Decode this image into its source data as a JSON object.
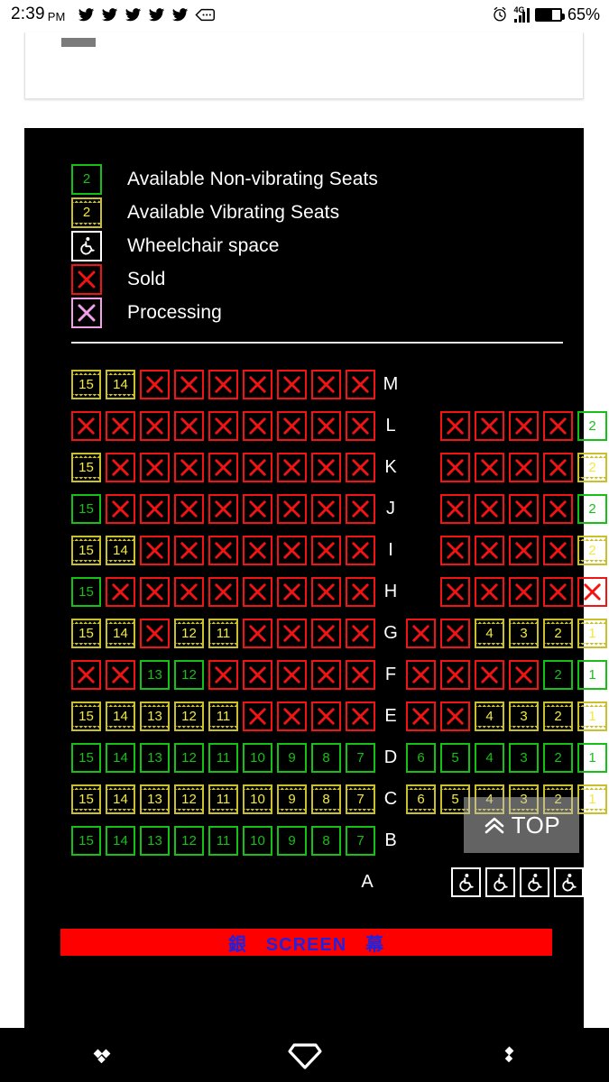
{
  "status_bar": {
    "time": "2:39",
    "ampm": "PM",
    "notification_icons": [
      "twitter-icon",
      "twitter-icon",
      "twitter-icon",
      "twitter-icon",
      "twitter-icon",
      "message-icon"
    ],
    "alarm_icon": "alarm-clock-icon",
    "network": "4G",
    "signal_bars": 4,
    "battery_percent": "65%",
    "battery_level": 65
  },
  "legend": {
    "items": [
      {
        "label": "Available Non-vibrating Seats",
        "style": "green",
        "text": "2",
        "icon": ""
      },
      {
        "label": "Available Vibrating Seats",
        "style": "vib",
        "text": "2",
        "icon": ""
      },
      {
        "label": "Wheelchair space",
        "style": "wheel",
        "text": "",
        "icon": "wheelchair-icon"
      },
      {
        "label": "Sold",
        "style": "sold",
        "text": "",
        "icon": "x-icon"
      },
      {
        "label": "Processing",
        "style": "proc",
        "text": "",
        "icon": "x-icon"
      }
    ]
  },
  "colors": {
    "available_green": "#16c116",
    "vibrating_yellow": "#c9c02c",
    "vibrating_text": "#f2ea3c",
    "sold_red": "#f21414",
    "processing_pink": "#f2a0e8",
    "wheelchair_white": "#ffffff",
    "panel_background": "#000000",
    "screen_bar_background": "#ff0000",
    "screen_bar_text": "#2222dd"
  },
  "seat_map": {
    "rows": [
      {
        "label": "M",
        "left": [
          {
            "t": "vib",
            "n": "15"
          },
          {
            "t": "vib",
            "n": "14"
          },
          {
            "t": "sold"
          },
          {
            "t": "sold"
          },
          {
            "t": "sold"
          },
          {
            "t": "sold"
          },
          {
            "t": "sold"
          },
          {
            "t": "sold"
          },
          {
            "t": "sold"
          }
        ],
        "right": []
      },
      {
        "label": "L",
        "left": [
          {
            "t": "sold"
          },
          {
            "t": "sold"
          },
          {
            "t": "sold"
          },
          {
            "t": "sold"
          },
          {
            "t": "sold"
          },
          {
            "t": "sold"
          },
          {
            "t": "sold"
          },
          {
            "t": "sold"
          },
          {
            "t": "sold"
          }
        ],
        "right": [
          {
            "t": "sold"
          },
          {
            "t": "sold"
          },
          {
            "t": "sold"
          },
          {
            "t": "sold"
          },
          {
            "t": "green",
            "n": "2"
          }
        ]
      },
      {
        "label": "K",
        "left": [
          {
            "t": "vib",
            "n": "15"
          },
          {
            "t": "sold"
          },
          {
            "t": "sold"
          },
          {
            "t": "sold"
          },
          {
            "t": "sold"
          },
          {
            "t": "sold"
          },
          {
            "t": "sold"
          },
          {
            "t": "sold"
          },
          {
            "t": "sold"
          }
        ],
        "right": [
          {
            "t": "sold"
          },
          {
            "t": "sold"
          },
          {
            "t": "sold"
          },
          {
            "t": "sold"
          },
          {
            "t": "vib",
            "n": "2"
          }
        ]
      },
      {
        "label": "J",
        "left": [
          {
            "t": "green",
            "n": "15"
          },
          {
            "t": "sold"
          },
          {
            "t": "sold"
          },
          {
            "t": "sold"
          },
          {
            "t": "sold"
          },
          {
            "t": "sold"
          },
          {
            "t": "sold"
          },
          {
            "t": "sold"
          },
          {
            "t": "sold"
          }
        ],
        "right": [
          {
            "t": "sold"
          },
          {
            "t": "sold"
          },
          {
            "t": "sold"
          },
          {
            "t": "sold"
          },
          {
            "t": "green",
            "n": "2"
          }
        ]
      },
      {
        "label": "I",
        "left": [
          {
            "t": "vib",
            "n": "15"
          },
          {
            "t": "vib",
            "n": "14"
          },
          {
            "t": "sold"
          },
          {
            "t": "sold"
          },
          {
            "t": "sold"
          },
          {
            "t": "sold"
          },
          {
            "t": "sold"
          },
          {
            "t": "sold"
          },
          {
            "t": "sold"
          }
        ],
        "right": [
          {
            "t": "sold"
          },
          {
            "t": "sold"
          },
          {
            "t": "sold"
          },
          {
            "t": "sold"
          },
          {
            "t": "vib",
            "n": "2"
          }
        ]
      },
      {
        "label": "H",
        "left": [
          {
            "t": "green",
            "n": "15"
          },
          {
            "t": "sold"
          },
          {
            "t": "sold"
          },
          {
            "t": "sold"
          },
          {
            "t": "sold"
          },
          {
            "t": "sold"
          },
          {
            "t": "sold"
          },
          {
            "t": "sold"
          },
          {
            "t": "sold"
          }
        ],
        "right": [
          {
            "t": "sold"
          },
          {
            "t": "sold"
          },
          {
            "t": "sold"
          },
          {
            "t": "sold"
          },
          {
            "t": "sold"
          }
        ]
      },
      {
        "label": "G",
        "left": [
          {
            "t": "vib",
            "n": "15"
          },
          {
            "t": "vib",
            "n": "14"
          },
          {
            "t": "sold"
          },
          {
            "t": "vib",
            "n": "12"
          },
          {
            "t": "vib",
            "n": "11"
          },
          {
            "t": "sold"
          },
          {
            "t": "sold"
          },
          {
            "t": "sold"
          },
          {
            "t": "sold"
          }
        ],
        "right": [
          {
            "t": "sold"
          },
          {
            "t": "sold"
          },
          {
            "t": "vib",
            "n": "4"
          },
          {
            "t": "vib",
            "n": "3"
          },
          {
            "t": "vib",
            "n": "2"
          },
          {
            "t": "vib",
            "n": "1"
          }
        ]
      },
      {
        "label": "F",
        "left": [
          {
            "t": "sold"
          },
          {
            "t": "sold"
          },
          {
            "t": "green",
            "n": "13"
          },
          {
            "t": "green",
            "n": "12"
          },
          {
            "t": "sold"
          },
          {
            "t": "sold"
          },
          {
            "t": "sold"
          },
          {
            "t": "sold"
          },
          {
            "t": "sold"
          }
        ],
        "right": [
          {
            "t": "sold"
          },
          {
            "t": "sold"
          },
          {
            "t": "sold"
          },
          {
            "t": "sold"
          },
          {
            "t": "green",
            "n": "2"
          },
          {
            "t": "green",
            "n": "1"
          }
        ]
      },
      {
        "label": "E",
        "left": [
          {
            "t": "vib",
            "n": "15"
          },
          {
            "t": "vib",
            "n": "14"
          },
          {
            "t": "vib",
            "n": "13"
          },
          {
            "t": "vib",
            "n": "12"
          },
          {
            "t": "vib",
            "n": "11"
          },
          {
            "t": "sold"
          },
          {
            "t": "sold"
          },
          {
            "t": "sold"
          },
          {
            "t": "sold"
          }
        ],
        "right": [
          {
            "t": "sold"
          },
          {
            "t": "sold"
          },
          {
            "t": "vib",
            "n": "4"
          },
          {
            "t": "vib",
            "n": "3"
          },
          {
            "t": "vib",
            "n": "2"
          },
          {
            "t": "vib",
            "n": "1"
          }
        ]
      },
      {
        "label": "D",
        "left": [
          {
            "t": "green",
            "n": "15"
          },
          {
            "t": "green",
            "n": "14"
          },
          {
            "t": "green",
            "n": "13"
          },
          {
            "t": "green",
            "n": "12"
          },
          {
            "t": "green",
            "n": "11"
          },
          {
            "t": "green",
            "n": "10"
          },
          {
            "t": "green",
            "n": "9"
          },
          {
            "t": "green",
            "n": "8"
          },
          {
            "t": "green",
            "n": "7"
          }
        ],
        "right": [
          {
            "t": "green",
            "n": "6"
          },
          {
            "t": "green",
            "n": "5"
          },
          {
            "t": "green",
            "n": "4"
          },
          {
            "t": "green",
            "n": "3"
          },
          {
            "t": "green",
            "n": "2"
          },
          {
            "t": "green",
            "n": "1"
          }
        ]
      },
      {
        "label": "C",
        "left": [
          {
            "t": "vib",
            "n": "15"
          },
          {
            "t": "vib",
            "n": "14"
          },
          {
            "t": "vib",
            "n": "13"
          },
          {
            "t": "vib",
            "n": "12"
          },
          {
            "t": "vib",
            "n": "11"
          },
          {
            "t": "vib",
            "n": "10"
          },
          {
            "t": "vib",
            "n": "9"
          },
          {
            "t": "vib",
            "n": "8"
          },
          {
            "t": "vib",
            "n": "7"
          }
        ],
        "right": [
          {
            "t": "vib",
            "n": "6"
          },
          {
            "t": "vib",
            "n": "5"
          },
          {
            "t": "vib",
            "n": "4"
          },
          {
            "t": "vib",
            "n": "3"
          },
          {
            "t": "vib",
            "n": "2"
          },
          {
            "t": "vib",
            "n": "1"
          }
        ]
      },
      {
        "label": "B",
        "left": [
          {
            "t": "green",
            "n": "15"
          },
          {
            "t": "green",
            "n": "14"
          },
          {
            "t": "green",
            "n": "13"
          },
          {
            "t": "green",
            "n": "12"
          },
          {
            "t": "green",
            "n": "11"
          },
          {
            "t": "green",
            "n": "10"
          },
          {
            "t": "green",
            "n": "9"
          },
          {
            "t": "green",
            "n": "8"
          },
          {
            "t": "green",
            "n": "7"
          }
        ],
        "right": []
      },
      {
        "label": "A",
        "left": [],
        "right": [
          {
            "t": "wheel"
          },
          {
            "t": "wheel"
          },
          {
            "t": "wheel"
          },
          {
            "t": "wheel"
          }
        ]
      }
    ]
  },
  "top_button": {
    "label": "TOP",
    "icon": "chevron-double-up-icon"
  },
  "screen_bar": {
    "label": "銀　SCREEN　幕"
  },
  "nav_bar": {
    "items": [
      {
        "name": "recents-button",
        "icon": "diamond-cluster-icon"
      },
      {
        "name": "home-button",
        "icon": "diamond-outline-icon"
      },
      {
        "name": "back-button",
        "icon": "diamond-pair-icon"
      }
    ]
  }
}
